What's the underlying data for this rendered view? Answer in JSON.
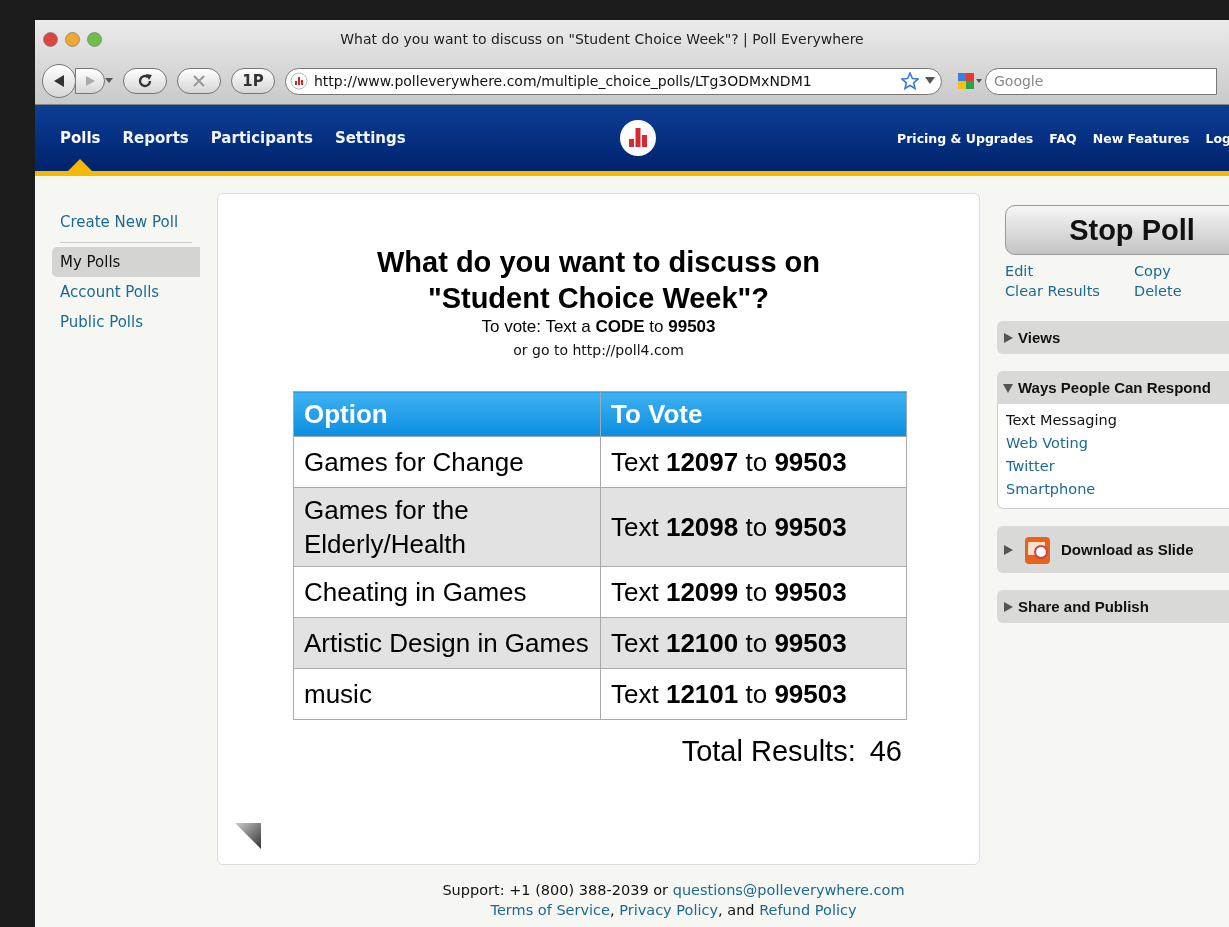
{
  "window": {
    "title": "What do you want to discuss on \"Student Choice Week\"? | Poll Everywhere"
  },
  "toolbar": {
    "reader_button": "1P",
    "address": "http://www.polleverywhere.com/multiple_choice_polls/LTg3ODMxNDM1",
    "search": {
      "placeholder": "Google"
    }
  },
  "nav": {
    "tabs": [
      {
        "label": "Polls",
        "selected": true
      },
      {
        "label": "Reports",
        "selected": false
      },
      {
        "label": "Participants",
        "selected": false
      },
      {
        "label": "Settings",
        "selected": false
      }
    ],
    "links": [
      "Pricing & Upgrades",
      "FAQ",
      "New Features",
      "Log"
    ]
  },
  "sidebar": {
    "items": [
      {
        "label": "Create New Poll",
        "kind": "action",
        "selected": false
      },
      {
        "label": "My Polls",
        "kind": "item",
        "selected": true
      },
      {
        "label": "Account Polls",
        "kind": "item",
        "selected": false
      },
      {
        "label": "Public Polls",
        "kind": "item",
        "selected": false
      }
    ]
  },
  "poll": {
    "question": "What do you want to discuss on \"Student Choice Week\"?",
    "instruction": "To vote: Text a **CODE** to **99503**",
    "web_hint": "or go to http://poll4.com",
    "table": {
      "columns": [
        "Option",
        "To Vote"
      ],
      "rows": [
        {
          "option": "Games for Change",
          "vote": "Text **12097** to **99503**"
        },
        {
          "option": "Games for the Elderly/Health",
          "vote": "Text **12098** to **99503**"
        },
        {
          "option": "Cheating in Games",
          "vote": "Text **12099** to **99503**"
        },
        {
          "option": "Artistic Design in Games",
          "vote": "Text **12100** to **99503**"
        },
        {
          "option": "music",
          "vote": "Text **12101** to **99503**"
        }
      ]
    },
    "total_label": "Total Results:",
    "total": "46"
  },
  "actions": {
    "primary": "Stop Poll",
    "links": [
      "Edit",
      "Copy",
      "Clear Results",
      "Delete"
    ],
    "panels": [
      {
        "title": "Views",
        "kind": "plain",
        "expanded": false
      },
      {
        "title": "Ways People Can Respond",
        "kind": "plain",
        "expanded": true,
        "items": [
          {
            "label": "Text Messaging",
            "selected": true
          },
          {
            "label": "Web Voting",
            "selected": false
          },
          {
            "label": "Twitter",
            "selected": false
          },
          {
            "label": "Smartphone",
            "selected": false
          }
        ]
      },
      {
        "title": "Download as Slide",
        "kind": "slide",
        "expanded": false
      },
      {
        "title": "Share and Publish",
        "kind": "plain",
        "expanded": false
      }
    ]
  },
  "footer": {
    "support": "Support: +1 (800) 388-2039 or ",
    "email": "questions@polleverywhere.com",
    "links": [
      "Terms of Service",
      "Privacy Policy",
      "Refund Policy"
    ],
    "separators": [
      ", ",
      ", and "
    ]
  }
}
